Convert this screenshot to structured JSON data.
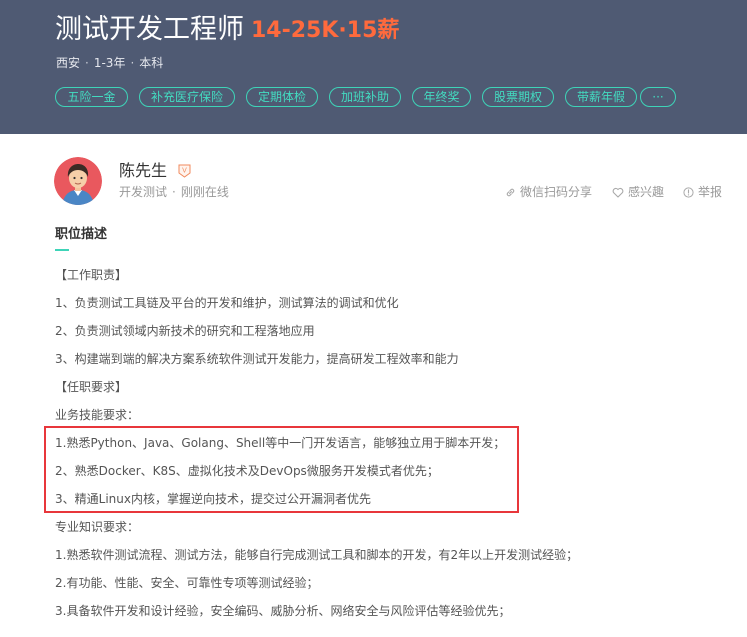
{
  "job": {
    "title": "测试开发工程师",
    "salary": "14-25K·15薪",
    "city": "西安",
    "experience": "1-3年",
    "education": "本科",
    "meta_separator": "·"
  },
  "tags": [
    "五险一金",
    "补充医疗保险",
    "定期体检",
    "加班补助",
    "年终奖",
    "股票期权",
    "带薪年假",
    "···"
  ],
  "recruiter": {
    "name": "陈先生",
    "verified_label": "V",
    "role": "开发测试",
    "status": "刚刚在线",
    "meta_separator": "·"
  },
  "actions": {
    "share": "微信扫码分享",
    "interest": "感兴趣",
    "report": "举报"
  },
  "section": {
    "title": "职位描述"
  },
  "description": [
    "【工作职责】",
    "1、负责测试工具链及平台的开发和维护，测试算法的调试和优化",
    "2、负责测试领域内新技术的研究和工程落地应用",
    "3、构建端到端的解决方案系统软件测试开发能力，提高研发工程效率和能力",
    "【任职要求】",
    "业务技能要求：",
    "1.熟悉Python、Java、Golang、Shell等中一门开发语言，能够独立用于脚本开发；",
    "2、熟悉Docker、K8S、虚拟化技术及DevOps微服务开发模式者优先；",
    "3、精通Linux内核，掌握逆向技术，提交过公开漏洞者优先",
    "专业知识要求：",
    "1.熟悉软件测试流程、测试方法，能够自行完成测试工具和脚本的开发，有2年以上开发测试经验；",
    "2.有功能、性能、安全、可靠性专项等测试经验；",
    "3.具备软件开发和设计经验，安全编码、威胁分析、网络安全与风险评估等经验优先；"
  ],
  "colors": {
    "header_bg": "#4f5a73",
    "salary": "#ff6a3d",
    "tag_accent": "#3ed4b8",
    "highlight": "#e8363b",
    "verified": "#f08a5d"
  }
}
